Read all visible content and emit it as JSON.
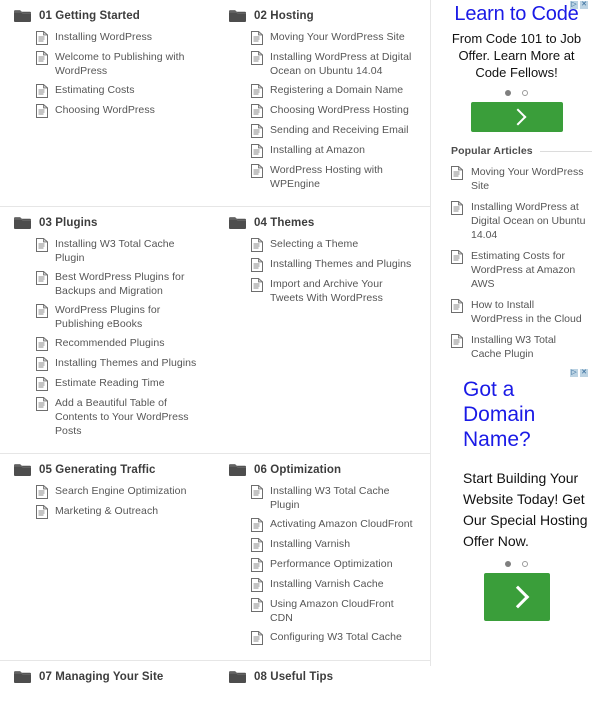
{
  "sitemap": {
    "sections": [
      {
        "title": "01 Getting Started",
        "icon": "folder-icon",
        "items": [
          "Installing WordPress",
          "Welcome to Publishing with WordPress",
          "Estimating Costs",
          "Choosing WordPress"
        ]
      },
      {
        "title": "02 Hosting",
        "icon": "folder-icon",
        "items": [
          "Moving Your WordPress Site",
          "Installing WordPress at Digital Ocean on Ubuntu 14.04",
          "Registering a Domain Name",
          "Choosing WordPress Hosting",
          "Sending and Receiving Email",
          "Installing at Amazon",
          "WordPress Hosting with WPEngine"
        ]
      },
      {
        "title": "03 Plugins",
        "icon": "folder-icon",
        "items": [
          "Installing W3 Total Cache Plugin",
          "Best WordPress Plugins for Backups and Migration",
          "WordPress Plugins for Publishing eBooks",
          "Recommended Plugins",
          "Installing Themes and Plugins",
          "Estimate Reading Time",
          "Add a Beautiful Table of Contents to Your WordPress Posts"
        ]
      },
      {
        "title": "04 Themes",
        "icon": "folder-icon",
        "items": [
          "Selecting a Theme",
          "Installing Themes and Plugins",
          "Import and Archive Your Tweets With WordPress"
        ]
      },
      {
        "title": "05 Generating Traffic",
        "icon": "folder-icon",
        "items": [
          "Search Engine Optimization",
          "Marketing & Outreach"
        ]
      },
      {
        "title": "06 Optimization",
        "icon": "folder-icon",
        "items": [
          "Installing W3 Total Cache Plugin",
          "Activating Amazon CloudFront",
          "Installing Varnish",
          "Performance Optimization",
          "Installing Varnish Cache",
          "Using Amazon CloudFront CDN",
          "Configuring W3 Total Cache"
        ]
      },
      {
        "title": "07 Managing Your Site",
        "icon": "folder-icon",
        "items": []
      },
      {
        "title": "08 Useful Tips",
        "icon": "folder-icon",
        "items": []
      }
    ]
  },
  "sidebar": {
    "ads": [
      {
        "headline": "Learn to Code",
        "body": "From Code 101 to Job Offer. Learn More at Code Fellows!",
        "adchoices_icons": [
          "▷",
          "✕"
        ],
        "dots": [
          "active",
          "inactive"
        ],
        "cta_icon": "chevron-right-icon",
        "cta_color": "#3a9e3a",
        "headline_color": "#1a1ae6"
      },
      {
        "headline": "Got a Domain Name?",
        "body": "Start Building Your Website Today! Get Our Special Hosting Offer Now.",
        "adchoices_icons": [
          "▷",
          "✕"
        ],
        "dots": [
          "active",
          "inactive"
        ],
        "cta_icon": "chevron-right-icon",
        "cta_color": "#3a9e3a",
        "headline_color": "#1a1ae6"
      }
    ],
    "popular": {
      "heading": "Popular Articles",
      "items": [
        "Moving Your WordPress Site",
        "Installing WordPress at Digital Ocean on Ubuntu 14.04",
        "Estimating Costs for WordPress at Amazon AWS",
        "How to Install WordPress in the Cloud",
        "Installing W3 Total Cache Plugin"
      ]
    }
  }
}
